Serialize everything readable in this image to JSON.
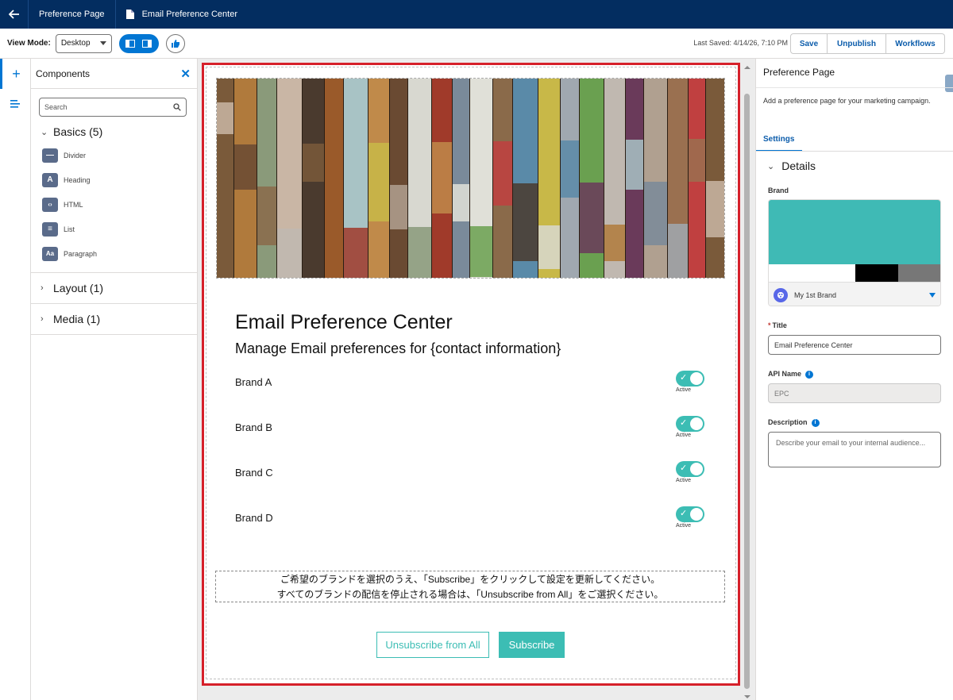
{
  "topbar": {
    "breadcrumb_1": "Preference Page",
    "breadcrumb_2": "Email Preference Center"
  },
  "toolbar": {
    "view_mode_label": "View Mode:",
    "view_mode_value": "Desktop",
    "last_saved": "Last Saved: 4/14/26, 7:10 PM",
    "save_label": "Save",
    "unpublish_label": "Unpublish",
    "workflows_label": "Workflows"
  },
  "components": {
    "title": "Components",
    "search_placeholder": "Search",
    "basics_title": "Basics (5)",
    "basics_items": [
      {
        "label": "Divider",
        "icon": "divider-icon",
        "glyph": "—"
      },
      {
        "label": "Heading",
        "icon": "heading-icon",
        "glyph": "A"
      },
      {
        "label": "HTML",
        "icon": "html-icon",
        "glyph": "‹›"
      },
      {
        "label": "List",
        "icon": "list-icon",
        "glyph": "≡"
      },
      {
        "label": "Paragraph",
        "icon": "paragraph-icon",
        "glyph": "Aa"
      }
    ],
    "layout_title": "Layout (1)",
    "media_title": "Media (1)"
  },
  "canvas": {
    "title": "Email Preference Center",
    "subtitle": "Manage Email preferences for {contact information}",
    "brands": [
      {
        "name": "Brand A",
        "status": "Active",
        "on": true
      },
      {
        "name": "Brand B",
        "status": "Active",
        "on": true
      },
      {
        "name": "Brand C",
        "status": "Active",
        "on": true
      },
      {
        "name": "Brand D",
        "status": "Active",
        "on": true
      }
    ],
    "notice_line1": "ご希望のブランドを選択のうえ、「Subscribe」をクリックして設定を更新してください。",
    "notice_line2": "すべてのブランドの配信を停止される場合は、「Unsubscribe from All」をご選択ください。",
    "unsubscribe_label": "Unsubscribe from All",
    "subscribe_label": "Subscribe",
    "accent_color": "#3cbdb4"
  },
  "properties": {
    "title": "Preference Page",
    "description": "Add a preference page for your marketing campaign.",
    "tab_settings": "Settings",
    "details_title": "Details",
    "brand_label": "Brand",
    "brand_value": "My 1st Brand",
    "brand_colors": [
      "#3fbab5",
      "#ffffff",
      "#000000",
      "#777777"
    ],
    "title_label": "Title",
    "title_value": "Email Preference Center",
    "api_label": "API Name",
    "api_value": "EPC",
    "desc_label": "Description",
    "desc_placeholder": "Describe your email to your internal audience..."
  }
}
